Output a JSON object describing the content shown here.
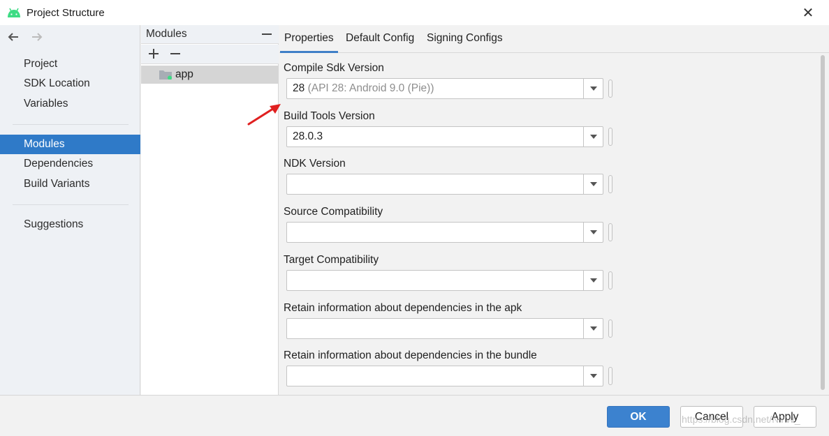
{
  "window": {
    "title": "Project Structure",
    "app_icon": "android-icon",
    "close_glyph": "✕"
  },
  "sidebar": {
    "back_glyph": "🡐",
    "forward_glyph": "🡒",
    "items": [
      {
        "label": "Project",
        "active": false
      },
      {
        "label": "SDK Location",
        "active": false
      },
      {
        "label": "Variables",
        "active": false
      },
      {
        "label": "Modules",
        "active": true
      },
      {
        "label": "Dependencies",
        "active": false
      },
      {
        "label": "Build Variants",
        "active": false
      },
      {
        "label": "Suggestions",
        "active": false
      }
    ]
  },
  "modules": {
    "title": "Modules",
    "collapse_glyph": "—",
    "add_glyph": "+",
    "remove_glyph": "−",
    "list": [
      {
        "name": "app",
        "icon": "module-folder-icon",
        "selected": true
      }
    ]
  },
  "tabs": [
    {
      "label": "Properties",
      "active": true
    },
    {
      "label": "Default Config",
      "active": false
    },
    {
      "label": "Signing Configs",
      "active": false
    }
  ],
  "fields": [
    {
      "label": "Compile Sdk Version",
      "value": "28",
      "hint": "(API 28: Android 9.0 (Pie))"
    },
    {
      "label": "Build Tools Version",
      "value": "28.0.3",
      "hint": ""
    },
    {
      "label": "NDK Version",
      "value": "",
      "hint": ""
    },
    {
      "label": "Source Compatibility",
      "value": "",
      "hint": ""
    },
    {
      "label": "Target Compatibility",
      "value": "",
      "hint": ""
    },
    {
      "label": "Retain information about dependencies in the apk",
      "value": "",
      "hint": ""
    },
    {
      "label": "Retain information about dependencies in the bundle",
      "value": "",
      "hint": ""
    }
  ],
  "buttons": {
    "ok": "OK",
    "cancel": "Cancel",
    "apply": "Apply"
  },
  "watermark": "https://blog.csdn.net/NYW_",
  "colors": {
    "accent": "#2f7ac8",
    "ok_button": "#3c82cf",
    "android_green": "#3ddc84",
    "annotation_red": "#e02020"
  }
}
